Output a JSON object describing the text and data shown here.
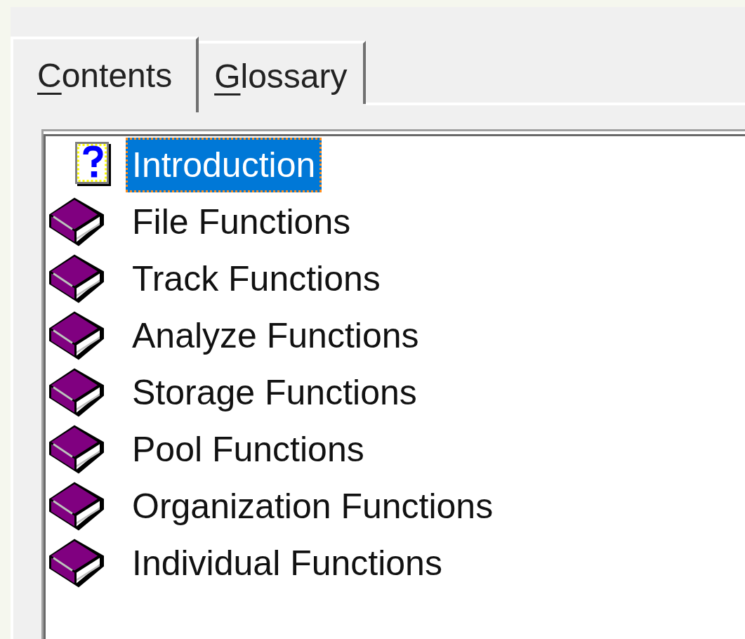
{
  "tabs": [
    {
      "mnemonic": "C",
      "rest": "ontents",
      "selected": true
    },
    {
      "mnemonic": "G",
      "rest": "lossary",
      "selected": false
    }
  ],
  "tree": {
    "items": [
      {
        "kind": "page",
        "label": "Introduction",
        "selected": true
      },
      {
        "kind": "book",
        "label": "File Functions",
        "selected": false
      },
      {
        "kind": "book",
        "label": "Track Functions",
        "selected": false
      },
      {
        "kind": "book",
        "label": "Analyze Functions",
        "selected": false
      },
      {
        "kind": "book",
        "label": "Storage Functions",
        "selected": false
      },
      {
        "kind": "book",
        "label": "Pool Functions",
        "selected": false
      },
      {
        "kind": "book",
        "label": "Organization Functions",
        "selected": false
      },
      {
        "kind": "book",
        "label": "Individual Functions",
        "selected": false
      }
    ]
  }
}
